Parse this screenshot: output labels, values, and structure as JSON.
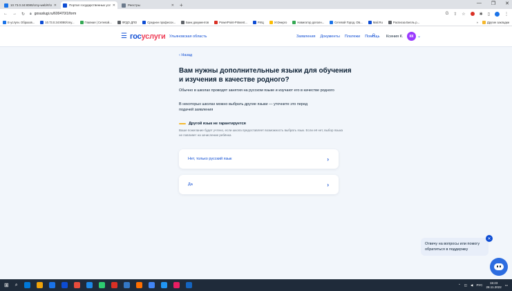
{
  "browser": {
    "tabs": [
      {
        "label": "10.73.0.34:8080/cmy-web/#/cm",
        "color": "#1a73e8",
        "active": false
      },
      {
        "label": "Портал государственных услуг",
        "color": "#0d4cd3",
        "active": true
      },
      {
        "label": "Реестры",
        "color": "#6b7a8c",
        "active": false
      }
    ],
    "url": "gosuslugi.ru/600470/1/form",
    "bookmarks": [
      {
        "label": "Е-услуги. Образов...",
        "color": "#1a73e8"
      },
      {
        "label": "10.73.0.34:8080/cmy...",
        "color": "#0d4cd3"
      },
      {
        "label": "Главная | Сетевой...",
        "color": "#34a853"
      },
      {
        "label": "ФГДО ДПО",
        "color": "#5f6368"
      },
      {
        "label": "Среднее професси...",
        "color": "#0d4cd3"
      },
      {
        "label": "Банк документов",
        "color": "#5f6368"
      },
      {
        "label": "PowerPoint-Präsent...",
        "color": "#d93025"
      },
      {
        "label": "РИЦ",
        "color": "#0d4cd3"
      },
      {
        "label": "УлЭнерго",
        "color": "#fbbc04"
      },
      {
        "label": "Навигатор дополн...",
        "color": "#34a853"
      },
      {
        "label": "Сетевой Город. ОБ...",
        "color": "#1a73e8"
      },
      {
        "label": "Mail.Ru",
        "color": "#0d4cd3"
      },
      {
        "label": "Расписка Белль р...",
        "color": "#5f6368"
      }
    ],
    "bookmarks_right": "Другие закладки"
  },
  "header": {
    "logo_part1": "гос",
    "logo_part2": "услуги",
    "region": "Ульяновская область",
    "nav": [
      "Заявления",
      "Документы",
      "Платежи",
      "Помощь"
    ],
    "user_name": "Ксения К.",
    "avatar_initials": "КК"
  },
  "main": {
    "back_label": "‹ Назад",
    "title": "Вам нужны дополнительные языки для обучения и изучения в качестве родного?",
    "paragraph1": "Обычно в школах проводят занятия на русском языке и изучают его в качестве родного",
    "paragraph2": "В некоторых школах можно выбрать другие языки — уточните это перед подачей заявления",
    "warning_title": "Другой язык не гарантируется",
    "warning_text": "Ваше пожелание будет учтено, если школа предоставляет возможность выбрать язык. Если её нет, выбор языка не повлияет на зачисление ребёнка",
    "options": [
      "Нет, только русский язык",
      "Да"
    ]
  },
  "support": {
    "text": "Отвечу на вопросы или помогу обратиться в поддержку"
  },
  "taskbar": {
    "time": "15:23",
    "date": "28.11.2022",
    "lang": "РУС",
    "icons": [
      "#0078d7",
      "#f0a30a",
      "#1a73e8",
      "#0d4cd3",
      "#e74c3c",
      "#1e88e5",
      "#2ecc71",
      "#d93025",
      "#3478c6",
      "#ff6f00",
      "#4285f4",
      "#2196f3",
      "#e91e63",
      "#1565c0"
    ]
  },
  "colors": {
    "accent": "#0d4cd3",
    "logo_red": "#ee3f58",
    "warning": "#f5b82d",
    "background": "#f2f6fb"
  }
}
